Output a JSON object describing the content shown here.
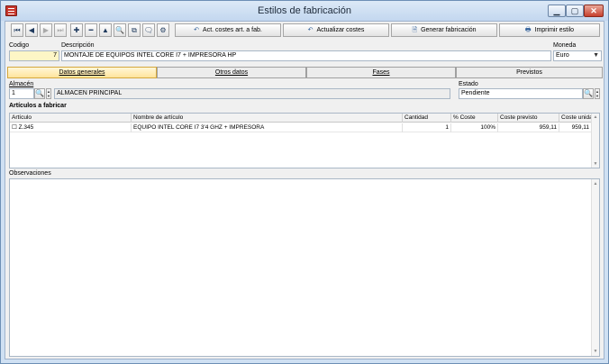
{
  "window": {
    "title": "Estilos de fabricación",
    "min_label": "▁",
    "max_label": "▢",
    "close_label": "✕"
  },
  "toolbar": {
    "nav_icons": [
      "⏮",
      "◀",
      "▶",
      "⏭",
      "✚",
      "━",
      "▲",
      "🔍",
      "⧉",
      "🗨",
      "⚙"
    ],
    "act_costes_label": "Act. costes art. a fab.",
    "actualizar_costes_label": "Actualizar costes",
    "generar_fabricacion_label": "Generar fabricación",
    "imprimir_estilo_label": "Imprimir estilo"
  },
  "header": {
    "codigo_label": "Codigo",
    "codigo_value": "7",
    "descripcion_label": "Descripción",
    "descripcion_value": "MONTAJE DE EQUIPOS INTEL CORE I7 + IMPRESORA HP",
    "moneda_label": "Moneda",
    "moneda_value": "Euro"
  },
  "tabs": [
    {
      "label": "Datos generales"
    },
    {
      "label": "Otros datos"
    },
    {
      "label": "Fases"
    },
    {
      "label": "Previstos"
    }
  ],
  "general": {
    "almacen_label": "Almacén",
    "almacen_code": "1",
    "almacen_name": "ALMACEN PRINCIPAL",
    "estado_label": "Estado",
    "estado_value": "Pendiente",
    "articulos_title": "Artículos a fabricar"
  },
  "grid": {
    "columns": [
      "Artículo",
      "Nombre de artículo",
      "Cantidad",
      "% Coste",
      "Coste previsto",
      "Coste unidad"
    ],
    "rows": [
      {
        "articulo": "Z.345",
        "nombre": "EQUIPO INTEL CORE I7 3'4 GHZ + IMPRESORA",
        "cantidad": "1",
        "coste_pct": "100%",
        "coste_previsto": "959,11",
        "coste_unidad": "959,11"
      }
    ]
  },
  "observaciones": {
    "label": "Observaciones",
    "value": ""
  }
}
